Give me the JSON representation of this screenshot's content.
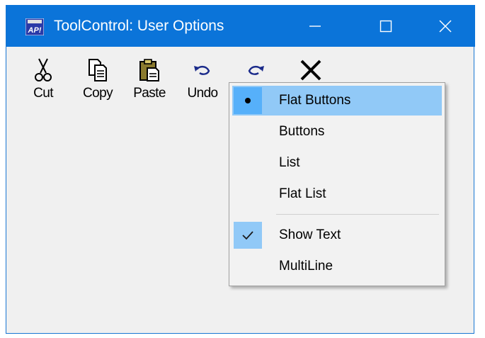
{
  "window": {
    "title": "ToolControl: User Options",
    "app_icon_text": "AP!",
    "title_bar_color": "#0b74d9",
    "controls": [
      "minimize",
      "maximize",
      "close"
    ]
  },
  "toolbar": {
    "buttons": [
      {
        "label": "Cut",
        "icon": "scissors-icon"
      },
      {
        "label": "Copy",
        "icon": "copy-icon"
      },
      {
        "label": "Paste",
        "icon": "paste-icon"
      },
      {
        "label": "Undo",
        "icon": "undo-icon"
      },
      {
        "label": "",
        "icon": "redo-icon"
      },
      {
        "label": "",
        "icon": "delete-x-icon"
      }
    ]
  },
  "context_menu": {
    "highlight_color": "#91c9f7",
    "items": [
      {
        "label": "Flat Buttons",
        "marker": "radio-dot",
        "selected": true,
        "highlighted": true
      },
      {
        "label": "Buttons",
        "marker": "",
        "selected": false
      },
      {
        "label": "List",
        "marker": "",
        "selected": false
      },
      {
        "label": "Flat List",
        "marker": "",
        "selected": false
      },
      {
        "label": "Show Text",
        "marker": "checkmark",
        "selected": true
      },
      {
        "label": "MultiLine",
        "marker": "",
        "selected": false
      }
    ]
  }
}
